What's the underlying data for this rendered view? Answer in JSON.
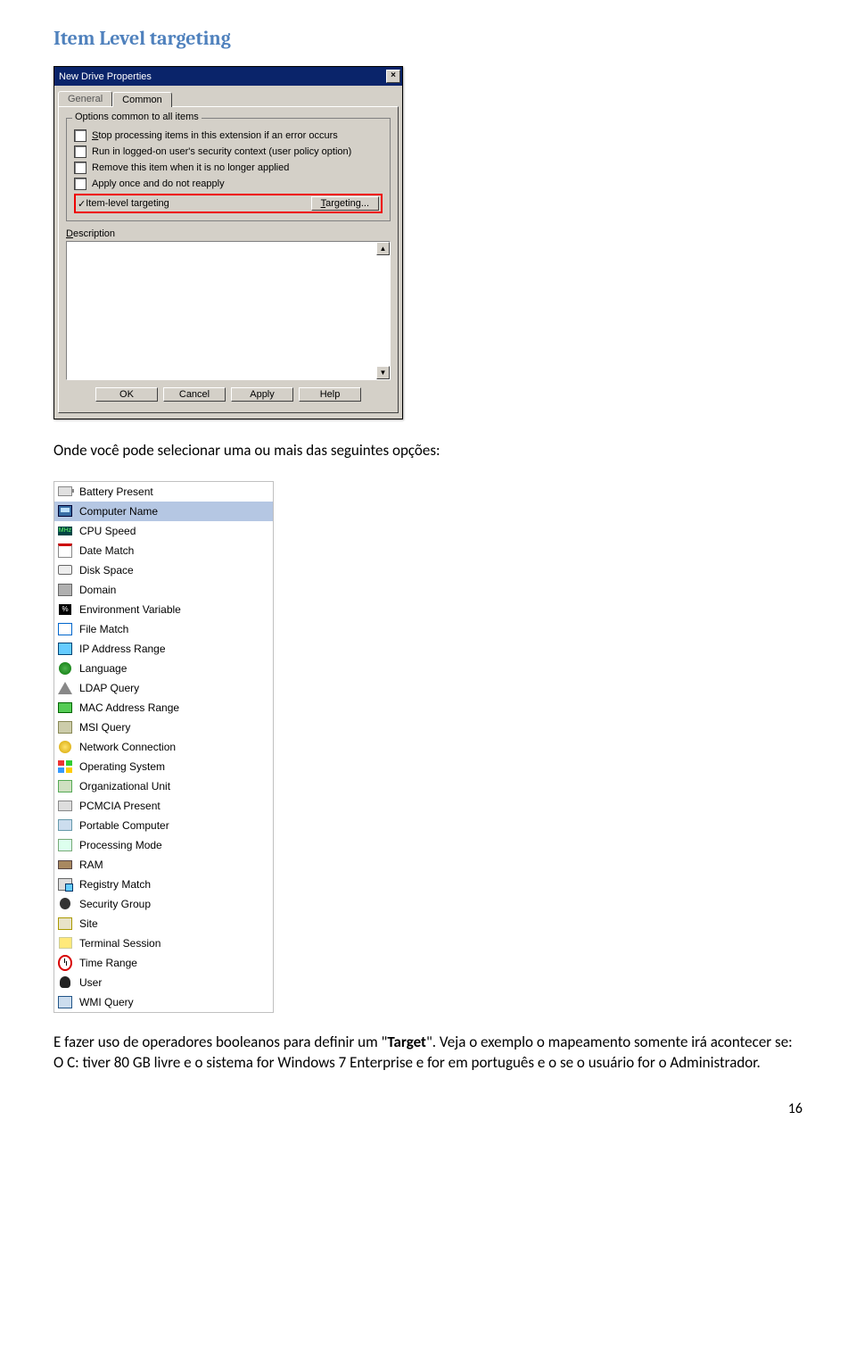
{
  "heading": "Item Level targeting",
  "dialog": {
    "title": "New Drive Properties",
    "tabs": {
      "general": "General",
      "common": "Common"
    },
    "group_legend": "Options common to all items",
    "checks": {
      "stop": "Stop processing items in this extension if an error occurs",
      "runctx": "Run in logged-on user's security context (user policy option)",
      "remove": "Remove this item when it is no longer applied",
      "applyonce": "Apply once and do not reapply",
      "itemlevel": "Item-level targeting",
      "targeting_btn": "Targeting..."
    },
    "desc_label": "Description",
    "desc_value": "",
    "buttons": {
      "ok": "OK",
      "cancel": "Cancel",
      "apply": "Apply",
      "help": "Help"
    }
  },
  "para1": "Onde você pode selecionar uma ou mais das seguintes opções:",
  "options": [
    {
      "key": "battery",
      "label": "Battery Present"
    },
    {
      "key": "computer",
      "label": "Computer Name"
    },
    {
      "key": "cpu",
      "label": "CPU Speed"
    },
    {
      "key": "date",
      "label": "Date Match"
    },
    {
      "key": "disk",
      "label": "Disk Space"
    },
    {
      "key": "domain",
      "label": "Domain"
    },
    {
      "key": "env",
      "label": "Environment Variable"
    },
    {
      "key": "file",
      "label": "File Match"
    },
    {
      "key": "ip",
      "label": "IP Address Range"
    },
    {
      "key": "lang",
      "label": "Language"
    },
    {
      "key": "ldap",
      "label": "LDAP Query"
    },
    {
      "key": "mac",
      "label": "MAC Address Range"
    },
    {
      "key": "msi",
      "label": "MSI Query"
    },
    {
      "key": "net",
      "label": "Network Connection"
    },
    {
      "key": "os",
      "label": "Operating System"
    },
    {
      "key": "ou",
      "label": "Organizational Unit"
    },
    {
      "key": "pcm",
      "label": "PCMCIA Present"
    },
    {
      "key": "port",
      "label": "Portable Computer"
    },
    {
      "key": "proc",
      "label": "Processing Mode"
    },
    {
      "key": "ram",
      "label": "RAM"
    },
    {
      "key": "reg",
      "label": "Registry Match"
    },
    {
      "key": "sec",
      "label": "Security Group"
    },
    {
      "key": "site",
      "label": "Site"
    },
    {
      "key": "term",
      "label": "Terminal Session"
    },
    {
      "key": "time",
      "label": "Time Range"
    },
    {
      "key": "user",
      "label": "User"
    },
    {
      "key": "wmi",
      "label": "WMI Query"
    }
  ],
  "selected_option": "computer",
  "para2_pre": "E fazer uso de operadores booleanos para definir um \"",
  "para2_bold": "Target",
  "para2_post": "\". Veja o exemplo o mapeamento somente irá acontecer se: O C: tiver 80 GB livre e o sistema for Windows 7 Enterprise e for em português e o se o usuário for o Administrador.",
  "page_number": "16",
  "icon_text": {
    "cpu": "MHz",
    "env": "%"
  }
}
